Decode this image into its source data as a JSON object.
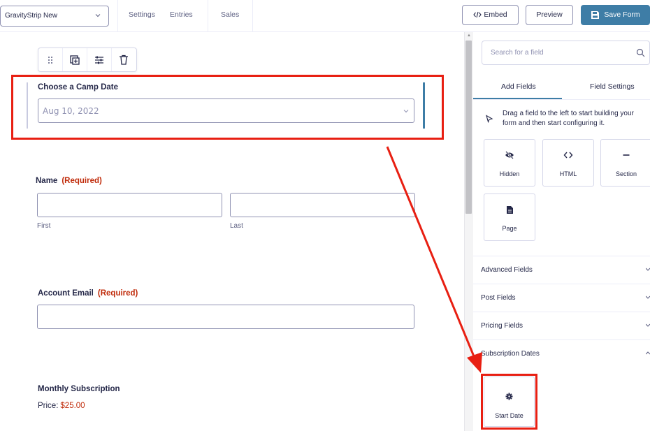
{
  "topbar": {
    "form_name": "GravityStrip New",
    "nav": [
      "Settings",
      "Entries",
      "Sales"
    ],
    "embed_label": "Embed",
    "preview_label": "Preview",
    "save_label": "Save Form",
    "accent": "#3e7da6"
  },
  "canvas": {
    "camp_date": {
      "label": "Choose a Camp Date",
      "placeholder": "Aug 10, 2022"
    },
    "name": {
      "label": "Name",
      "required": "(Required)",
      "first": "First",
      "last": "Last"
    },
    "email": {
      "label": "Account Email",
      "required": "(Required)"
    },
    "subscription": {
      "label": "Monthly Subscription",
      "price_label": "Price:",
      "price_value": "$25.00"
    },
    "toolbar_icons": [
      "drag-handle-icon",
      "duplicate-icon",
      "settings-sliders-icon",
      "trash-icon"
    ]
  },
  "sidebar": {
    "search_placeholder": "Search for a field",
    "tabs": [
      "Add Fields",
      "Field Settings"
    ],
    "hint": "Drag a field to the left to start building your form and then start configuring it.",
    "fields": [
      {
        "label": "Hidden",
        "icon": "eye-slash-icon"
      },
      {
        "label": "HTML",
        "icon": "code-icon"
      },
      {
        "label": "Section",
        "icon": "minus-icon"
      },
      {
        "label": "Page",
        "icon": "document-icon"
      }
    ],
    "sections": [
      {
        "label": "Advanced Fields",
        "expanded": false
      },
      {
        "label": "Post Fields",
        "expanded": false
      },
      {
        "label": "Pricing Fields",
        "expanded": false
      },
      {
        "label": "Subscription Dates",
        "expanded": true
      }
    ],
    "subscription_field": {
      "label": "Start Date",
      "icon": "gear-icon"
    }
  },
  "annotation_color": "#e81f12"
}
